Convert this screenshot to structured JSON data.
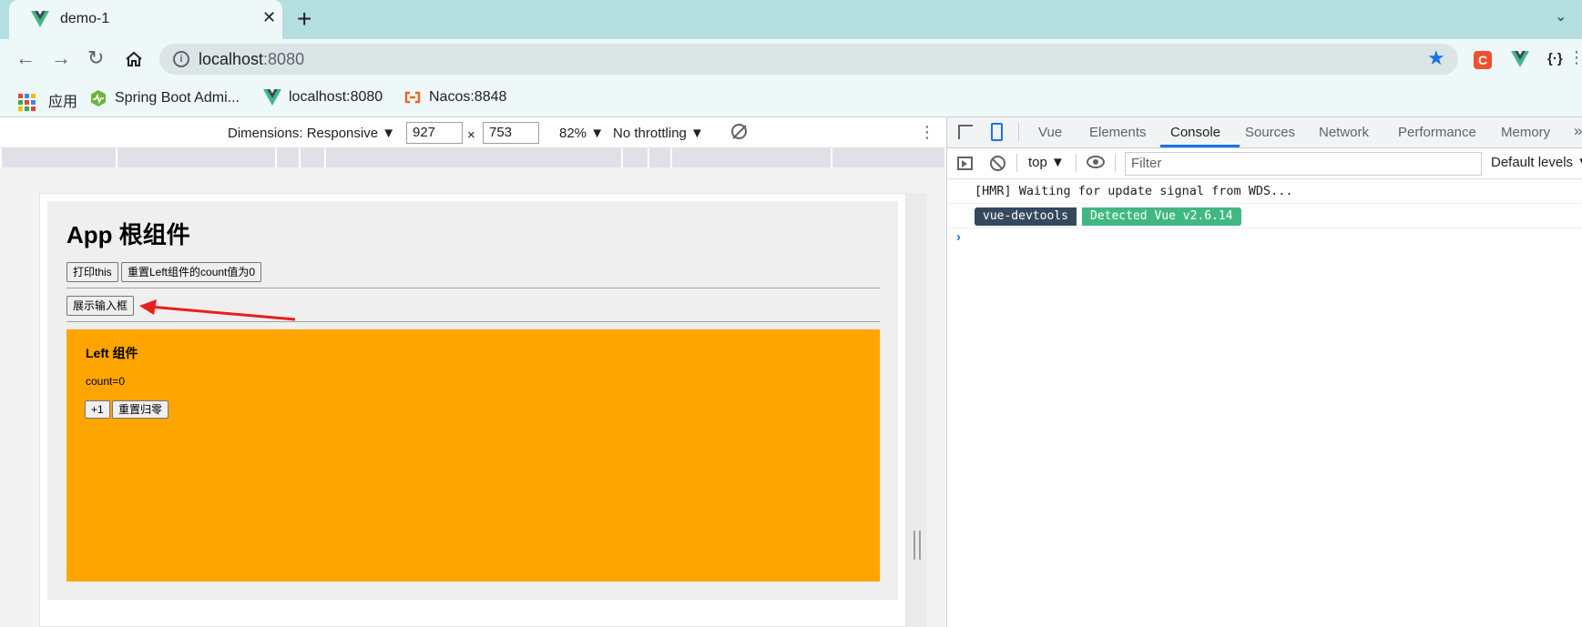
{
  "browser": {
    "tab_title": "demo-1",
    "tab_close": "✕",
    "new_tab": "+",
    "tab_menu": "⌄",
    "url_host": "localhost",
    "url_port": ":8080",
    "accent_color": "#1a73e8",
    "bookmarks": [
      {
        "label": "应用",
        "icon": "apps-grid-icon"
      },
      {
        "label": "Spring Boot Admi...",
        "icon": "spring-boot-admin-icon"
      },
      {
        "label": "localhost:8080",
        "icon": "vue-logo-icon"
      },
      {
        "label": "Nacos:8848",
        "icon": "nacos-icon"
      }
    ],
    "extension_c": "C",
    "extension_braces": "{·}"
  },
  "device_toolbar": {
    "dimensions_label": "Dimensions: Responsive ▼",
    "width_value": "927",
    "times": "×",
    "height_value": "753",
    "zoom": "82% ▼",
    "throttling": "No throttling ▼"
  },
  "app": {
    "title": "App 根组件",
    "print_this_button": "打印this",
    "reset_left_button": "重置Left组件的count值为0",
    "show_input_button": "展示输入框",
    "left": {
      "title": "Left 组件",
      "count_text": "count=0",
      "plus_button": "+1",
      "reset_button": "重置归零",
      "background": "#ffa500"
    }
  },
  "devtools": {
    "tabs": [
      "Vue",
      "Elements",
      "Console",
      "Sources",
      "Network",
      "Performance",
      "Memory"
    ],
    "active_tab": "Console",
    "context": "top ▼",
    "filter_placeholder": "Filter",
    "levels": "Default levels ▼",
    "log_line": "[HMR] Waiting for update signal from WDS...",
    "badge_left": "vue-devtools",
    "badge_right": "Detected Vue v2.6.14",
    "prompt": "›"
  }
}
